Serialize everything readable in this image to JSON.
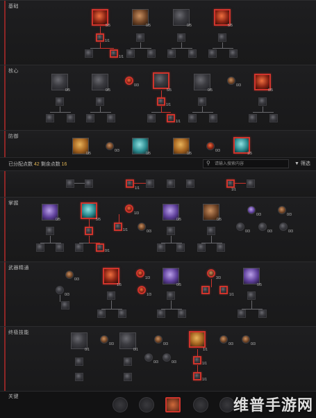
{
  "sections": {
    "s1": "基础",
    "s2": "核心",
    "s3": "防御",
    "s4": "掌握",
    "s5": "武器精通",
    "s6": "终极技能",
    "s7": "关键"
  },
  "toolbar": {
    "points_label_a": "已分配点数",
    "points_allocated": "42",
    "points_label_b": "剩余点数",
    "points_remaining": "16",
    "search_placeholder": "请输入搜索内容",
    "filter_label": "筛选"
  },
  "counts": {
    "c0_5": "0/5",
    "c1_5": "1/5",
    "c5_5": "5/5",
    "c1_1": "1/1",
    "c0_1": "0/1",
    "c0_3": "0/3",
    "c1_3": "1/3",
    "c3_3": "3/3"
  },
  "watermark": "维普手游网"
}
